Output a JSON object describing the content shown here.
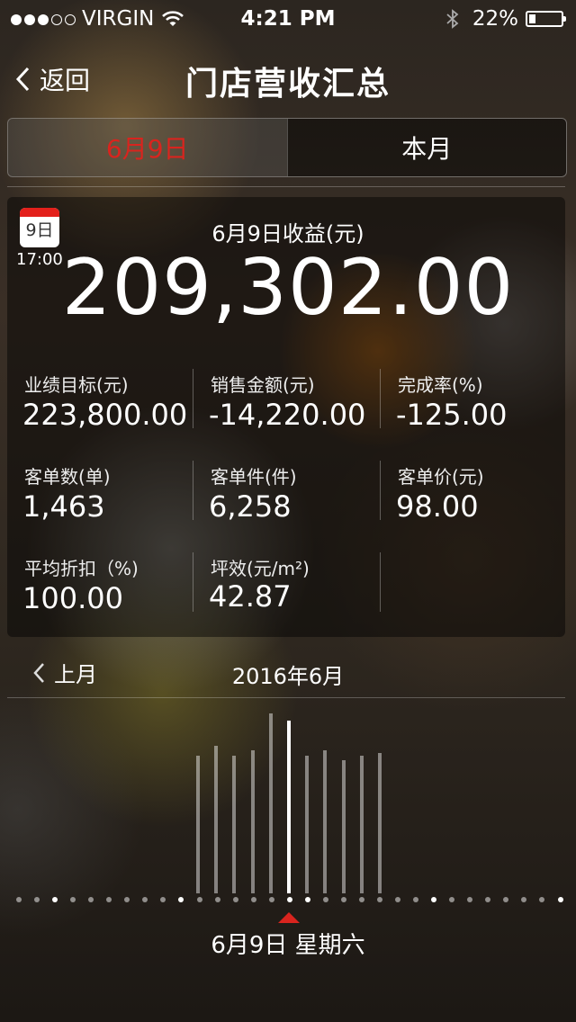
{
  "status_bar": {
    "carrier": "VIRGIN",
    "signal_dots": [
      1,
      1,
      1,
      0,
      0
    ],
    "time": "4:21 PM",
    "battery": "22%",
    "battery_level": 0.22
  },
  "nav": {
    "back_label": "返回",
    "title": "门店营收汇总"
  },
  "tabs": [
    {
      "label": "6月9日",
      "active": true,
      "color": "#d9241e"
    },
    {
      "label": "本月",
      "active": false
    }
  ],
  "summary": {
    "calendar_day": "9日",
    "calendar_time": "17:00",
    "revenue_label": "6月9日收益(元)",
    "revenue_value": "209,302.00"
  },
  "stats": [
    {
      "label": "业绩目标(元)",
      "value": "223,800.00"
    },
    {
      "label": "销售金额(元)",
      "value": "-14,220.00"
    },
    {
      "label": "完成率(%)",
      "value": "-125.00"
    },
    {
      "label": "客单数(单)",
      "value": "1,463"
    },
    {
      "label": "客单件(件)",
      "value": "6,258"
    },
    {
      "label": "客单价(元)",
      "value": "98.00"
    },
    {
      "label": "平均折扣（%)",
      "value": "100.00"
    },
    {
      "label": "坪效(元/m²)",
      "value": "42.87"
    }
  ],
  "month_nav": {
    "prev_label": "上月",
    "current_month": "2016年6月"
  },
  "day_bars": {
    "values": [
      0.59,
      0.63,
      0.59,
      0.61,
      0.77,
      0.74,
      0.59,
      0.61,
      0.57,
      0.59,
      0.6
    ],
    "selected_index": 5
  },
  "timeline_dots": {
    "count": 31,
    "bright": [
      2,
      9,
      16,
      23,
      30
    ],
    "selected_index": 15
  },
  "selected_date_label": "6月9日  星期六",
  "colors": {
    "accent_red": "#d9241e"
  }
}
